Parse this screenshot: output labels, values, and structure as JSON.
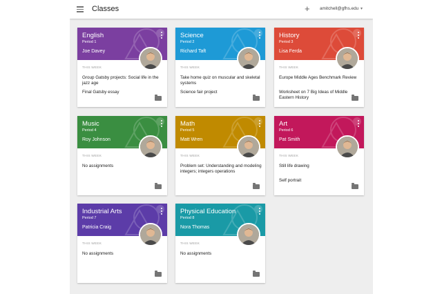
{
  "header": {
    "title": "Classes",
    "account": "amitchell@gfhs.edu",
    "plus_icon": "plus-icon",
    "menu_icon": "menu-icon",
    "dropdown_icon": "chevron-down-icon"
  },
  "this_week_label": "THIS WEEK",
  "classes": [
    {
      "name": "English",
      "period": "Period 1",
      "teacher": "Joe Davey",
      "color": "#7b3fa0",
      "assignments": [
        "Group Gatsby projects: Social life in the jazz age",
        "Final Gatsby essay"
      ]
    },
    {
      "name": "Science",
      "period": "Period 2",
      "teacher": "Richard Taft",
      "color": "#1e9ad6",
      "assignments": [
        "Take home quiz on muscular and skeletal systems",
        "Science fair project"
      ]
    },
    {
      "name": "History",
      "period": "Period 3",
      "teacher": "Lisa Ferda",
      "color": "#dd4b39",
      "assignments": [
        "Europe Middle Ages Benchmark Review",
        "Worksheet on 7 Big Ideas of Middle Eastern History"
      ]
    },
    {
      "name": "Music",
      "period": "Period 4",
      "teacher": "Roy Johnson",
      "color": "#3a8e41",
      "assignments": [
        "No assignments"
      ]
    },
    {
      "name": "Math",
      "period": "Period 5",
      "teacher": "Matt Wren",
      "color": "#c08a00",
      "assignments": [
        "Problem set: Understanding and modeling integers; integers operations"
      ]
    },
    {
      "name": "Art",
      "period": "Period 6",
      "teacher": "Pat Smith",
      "color": "#c2185b",
      "assignments": [
        "Still life drawing",
        "Self portrait"
      ]
    },
    {
      "name": "Industrial Arts",
      "period": "Period 7",
      "teacher": "Patricia Craig",
      "color": "#5c3ca8",
      "assignments": [
        "No assignments"
      ]
    },
    {
      "name": "Physical Education",
      "period": "Period 8",
      "teacher": "Nora Thomas",
      "color": "#1a9aa6",
      "assignments": [
        "No assignments"
      ]
    }
  ]
}
